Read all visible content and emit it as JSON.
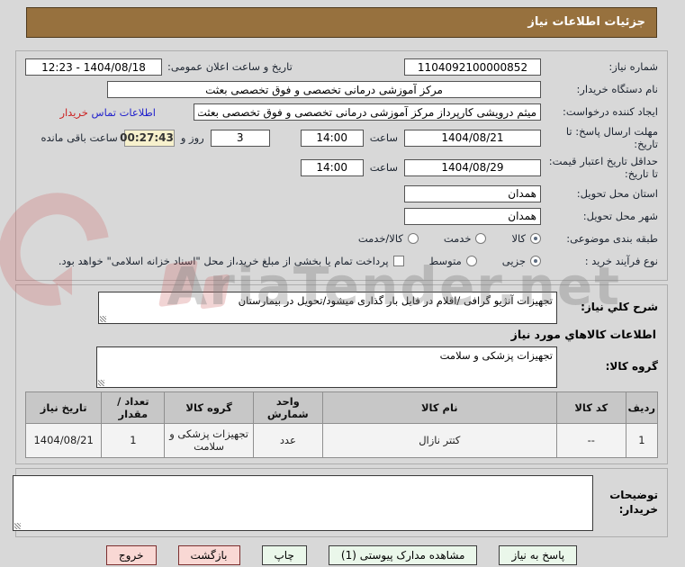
{
  "header": {
    "title": "جزئیات اطلاعات نیاز"
  },
  "watermark": {
    "text": "AriaTender.net"
  },
  "details": {
    "need_number": {
      "label": "شماره نیاز:",
      "value": "1104092100000852"
    },
    "announce": {
      "label": "تاریخ و ساعت اعلان عمومی:",
      "value": "1404/08/18 - 12:23"
    },
    "buyer_org": {
      "label": "نام دستگاه خریدار:",
      "value": "مرکز آموزشی درمانی تخصصی و فوق تخصصی بعثت"
    },
    "request_creator": {
      "label": "ایجاد کننده درخواست:",
      "value": "میثم درویشی کارپرداز مرکز آموزشی درمانی تخصصی و فوق تخصصی بعثت",
      "contact_link_blue": "اطلاعات تماس",
      "contact_link_red": "خریدار"
    },
    "deadline": {
      "label": "مهلت ارسال پاسخ: تا تاریخ:",
      "date": "1404/08/21",
      "hour_label": "ساعت",
      "time": "14:00",
      "days_value": "3",
      "days_label": "روز و",
      "countdown": "00:27:43",
      "remaining_label": "ساعت باقی مانده"
    },
    "price_validity": {
      "label": "حداقل تاریخ اعتبار قیمت: تا تاریخ:",
      "date": "1404/08/29",
      "hour_label": "ساعت",
      "time": "14:00"
    },
    "province": {
      "label": "استان محل تحویل:",
      "value": "همدان"
    },
    "city": {
      "label": "شهر محل تحویل:",
      "value": "همدان"
    },
    "classification": {
      "label": "طبقه بندی موضوعی:",
      "options": [
        {
          "label": "کالا",
          "selected": true
        },
        {
          "label": "خدمت",
          "selected": false
        },
        {
          "label": "کالا/خدمت",
          "selected": false
        }
      ]
    },
    "process_type": {
      "label": "نوع فرآیند خرید :",
      "options": [
        {
          "label": "جزیی",
          "selected": true
        },
        {
          "label": "متوسط",
          "selected": false
        }
      ],
      "checkbox_label": "پرداخت تمام یا بخشی از مبلغ خرید،از محل \"اسناد خزانه اسلامی\" خواهد بود.",
      "checkbox_checked": false
    }
  },
  "need_description": {
    "label": "شرح کلي نیاز:",
    "value": "تجهیزات آنژیو گرافی /اقلام در فایل بار گذاری میشود/تحویل در بیمارستان"
  },
  "goods_info_heading": "اطلاعات کالاهاي مورد نیاز",
  "goods_group": {
    "label": "گروه کالا:",
    "value": "تجهیزات پزشکی و سلامت"
  },
  "table": {
    "headers": [
      "ردیف",
      "کد کالا",
      "نام کالا",
      "واحد شمارش",
      "گروه کالا",
      "تعداد / مقدار",
      "تاریخ نیاز"
    ],
    "rows": [
      [
        "1",
        "--",
        "کتتر نازال",
        "عدد",
        "تجهیزات پزشکی و سلامت",
        "1",
        "1404/08/21"
      ]
    ]
  },
  "buyer_notes": {
    "label": "توضیحات خریدار:",
    "value": ""
  },
  "buttons": [
    {
      "label": "پاسخ به نیاز",
      "style": "green"
    },
    {
      "label": "مشاهده مدارک پیوستی (1)",
      "style": "green"
    },
    {
      "label": "چاپ",
      "style": "green"
    },
    {
      "label": "بازگشت",
      "style": "pink"
    },
    {
      "label": "خروج",
      "style": "pink"
    }
  ],
  "colors": {
    "title_bar": "#97713E",
    "countdown_bg": "#F7F1CD",
    "button_green": "#EAF7EA",
    "button_pink": "#F9D8D4",
    "link_blue": "#2222CC",
    "link_red": "#CC2222",
    "watermark_gray": "#7D7D7D",
    "watermark_red": "#CD6464"
  }
}
